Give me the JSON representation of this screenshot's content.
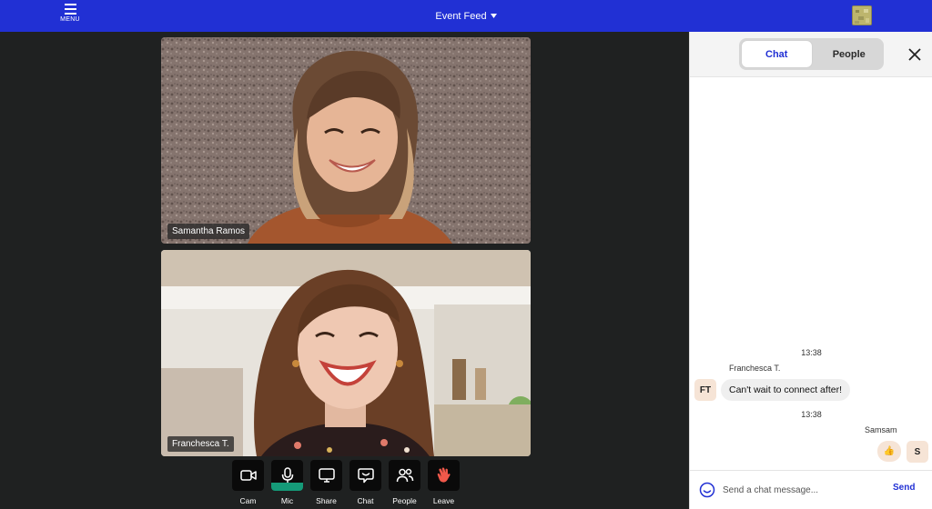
{
  "topbar": {
    "menu_label": "MENU",
    "title": "Event Feed",
    "title_icon": "caret-down-icon",
    "accent_color": "#2130d4"
  },
  "videos": [
    {
      "name": "Samantha Ramos"
    },
    {
      "name": "Franchesca T."
    }
  ],
  "controls": [
    {
      "label": "Cam",
      "icon": "camera-icon",
      "active": false
    },
    {
      "label": "Mic",
      "icon": "microphone-icon",
      "active": true
    },
    {
      "label": "Share",
      "icon": "screen-share-icon",
      "active": false
    },
    {
      "label": "Chat",
      "icon": "chat-bubble-icon",
      "active": false
    },
    {
      "label": "People",
      "icon": "people-icon",
      "active": false
    },
    {
      "label": "Leave",
      "icon": "wave-hand-icon",
      "active": false
    }
  ],
  "sidebar": {
    "tabs": [
      {
        "label": "Chat",
        "active": true
      },
      {
        "label": "People",
        "active": false
      }
    ],
    "messages": [
      {
        "time": "13:38",
        "sender": "Franchesca T.",
        "initials": "FT",
        "text": "Can't wait to connect after!"
      },
      {
        "time": "13:38",
        "sender": "Samsam",
        "initials": "S",
        "reaction": "👍"
      }
    ],
    "composer": {
      "placeholder": "Send a chat message...",
      "send_label": "Send"
    }
  },
  "colors": {
    "topbar": "#2130d4",
    "stage_bg": "#1f2121",
    "mic_active": "#159a78",
    "initials_bg": "#f6e4d6"
  }
}
